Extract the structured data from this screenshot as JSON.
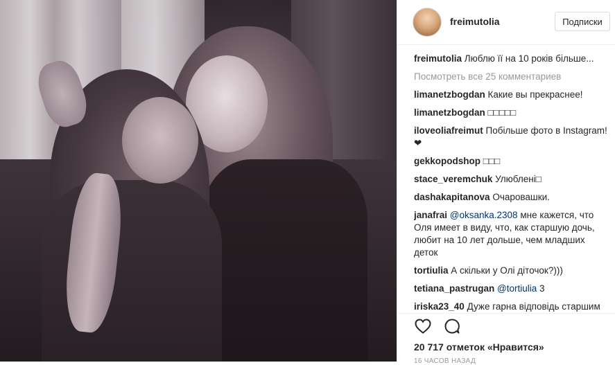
{
  "header": {
    "username": "freimutolia",
    "follow_label": "Подписки"
  },
  "caption": {
    "user": "freimutolia",
    "text": "Люблю її на 10 років більше..."
  },
  "view_all": "Посмотреть все 25 комментариев",
  "comments": [
    {
      "user": "limanetzbogdan",
      "parts": [
        {
          "t": "Какие вы прекраснее!"
        }
      ]
    },
    {
      "user": "limanetzbogdan",
      "parts": [
        {
          "t": "□□□□□"
        }
      ]
    },
    {
      "user": "iloveoliafreimut",
      "parts": [
        {
          "t": "Побільше фото в Instagram! ❤"
        }
      ]
    },
    {
      "user": "gekkopodshop",
      "parts": [
        {
          "t": "□□□"
        }
      ]
    },
    {
      "user": "stace_veremchuk",
      "parts": [
        {
          "t": "Улюблені□"
        }
      ]
    },
    {
      "user": "dashakapitanova",
      "parts": [
        {
          "t": "Очаровашки."
        }
      ]
    },
    {
      "user": "janafrai",
      "parts": [
        {
          "t": "@oksanka.2308",
          "mention": true
        },
        {
          "t": " мне кажется, что Оля имеет в виду, что, как старшую дочь, любит на 10 лет дольше, чем младших деток"
        }
      ]
    },
    {
      "user": "tortiulia",
      "parts": [
        {
          "t": "А скільки у Олі діточок?)))"
        }
      ]
    },
    {
      "user": "tetiana_pastrugan",
      "parts": [
        {
          "t": "@tortiulia",
          "mention": true
        },
        {
          "t": " 3"
        }
      ]
    },
    {
      "user": "iriska23_40",
      "parts": [
        {
          "t": "Дуже гарна відповідь старшим дітям )) Любою тебе не в років"
        }
      ]
    }
  ],
  "likes": "20 717 отметок «Нравится»",
  "timestamp": "16 часов назад",
  "icons": [
    "heart-icon",
    "comment-icon"
  ]
}
